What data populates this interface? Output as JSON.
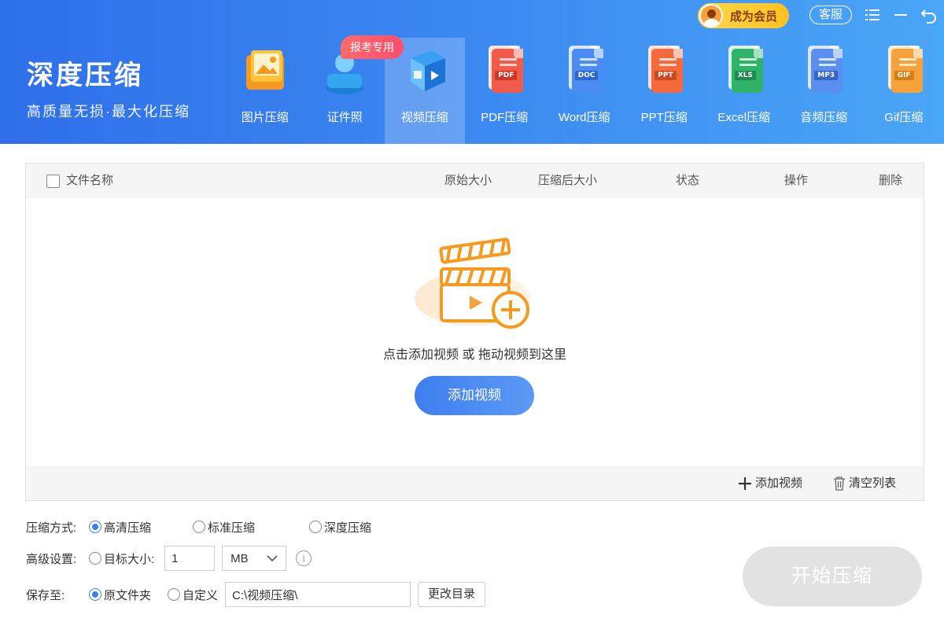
{
  "brand": {
    "title": "深度压缩",
    "subtitle": "高质量无损·最大化压缩"
  },
  "topbar": {
    "vip_label": "成为会员",
    "service_label": "客服",
    "menu_icon": "menu-icon",
    "minimize_icon": "minimize-icon",
    "close_icon": "back-arrow-icon"
  },
  "badge": {
    "label": "报考专用"
  },
  "tools": [
    {
      "label": "图片压缩",
      "icon": "image-compress-icon"
    },
    {
      "label": "证件照",
      "icon": "id-photo-icon"
    },
    {
      "label": "视频压缩",
      "icon": "video-compress-icon",
      "active": true
    },
    {
      "label": "PDF压缩",
      "icon": "pdf-icon",
      "tag": "PDF",
      "color": "#f25a4a"
    },
    {
      "label": "Word压缩",
      "icon": "word-icon",
      "tag": "DOC",
      "color": "#4a8cf2"
    },
    {
      "label": "PPT压缩",
      "icon": "ppt-icon",
      "tag": "PPT",
      "color": "#f46a3c"
    },
    {
      "label": "Excel压缩",
      "icon": "excel-icon",
      "tag": "XLS",
      "color": "#2fb36a"
    },
    {
      "label": "音频压缩",
      "icon": "audio-icon",
      "tag": "MP3",
      "color": "#5a8ff0"
    },
    {
      "label": "Gif压缩",
      "icon": "gif-icon",
      "tag": "GIF",
      "color": "#f5a23a"
    }
  ],
  "table": {
    "headers": {
      "name": "文件名称",
      "original_size": "原始大小",
      "compressed_size": "压缩后大小",
      "status": "状态",
      "action": "操作",
      "delete": "删除"
    },
    "empty_hint": "点击添加视频 或 拖动视频到这里",
    "add_button": "添加视频",
    "footer": {
      "add_label": "添加视频",
      "clear_label": "清空列表"
    }
  },
  "settings": {
    "mode": {
      "label": "压缩方式:",
      "options": [
        "高清压缩",
        "标准压缩",
        "深度压缩"
      ],
      "selected": "高清压缩"
    },
    "advanced": {
      "label": "高级设置:",
      "target_size_label": "目标大小:",
      "target_value": "1",
      "unit": "MB"
    },
    "save": {
      "label": "保存至:",
      "option_original": "原文件夹",
      "option_custom": "自定义",
      "path": "C:\\视频压缩\\",
      "change_dir": "更改目录"
    }
  },
  "start_button": "开始压缩",
  "colors": {
    "accent": "#3e7ef0",
    "header_start": "#2f6fea",
    "header_end": "#4aa6f7",
    "vip": "#ffc21f",
    "badge": "#ff4d6d"
  }
}
